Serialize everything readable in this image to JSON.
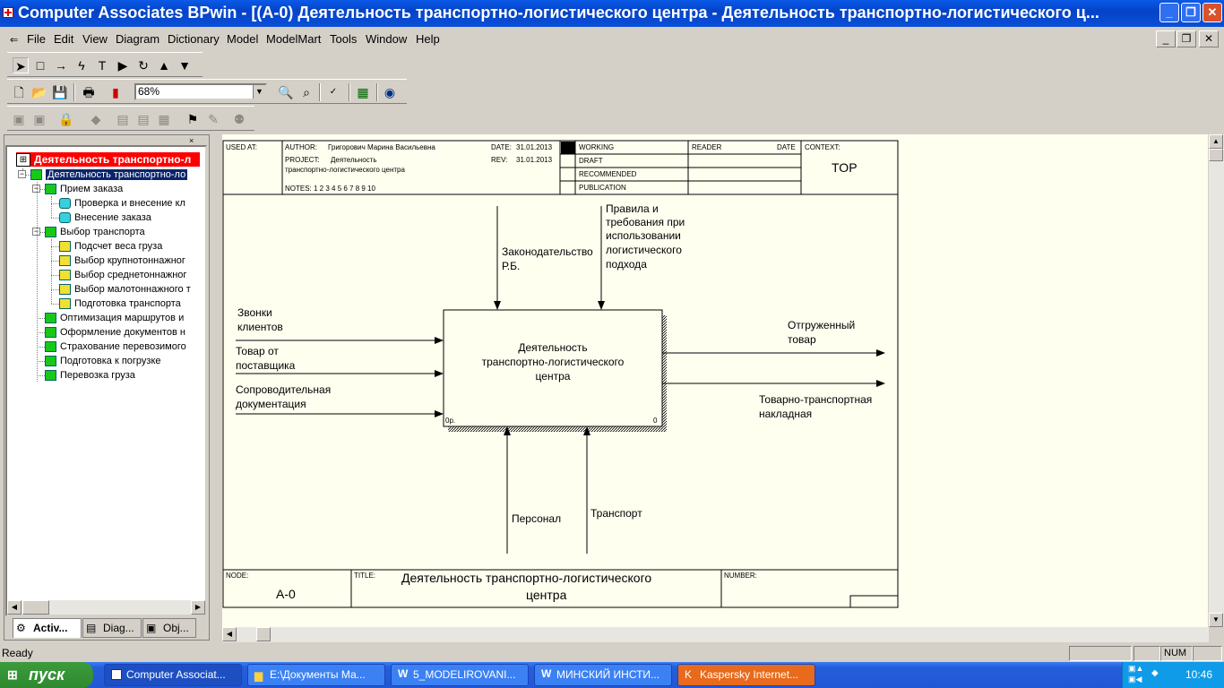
{
  "window": {
    "title": "Computer Associates BPwin - [(A-0) Деятельность  транспортно-логистического  центра - Деятельность транспортно-логистического ц..."
  },
  "menu": [
    "File",
    "Edit",
    "View",
    "Diagram",
    "Dictionary",
    "Model",
    "ModelMart",
    "Tools",
    "Window",
    "Help"
  ],
  "toolbar": {
    "zoom": "68%"
  },
  "tree": {
    "root": "Деятельность транспортно-л",
    "items": [
      {
        "label": "Деятельность транспортно-ло",
        "level": 1,
        "icon": "green",
        "selected": true
      },
      {
        "label": "Прием  заказа",
        "level": 2,
        "icon": "green"
      },
      {
        "label": "Проверка и внесение  кл",
        "level": 3,
        "icon": "cyan"
      },
      {
        "label": "Внесение  заказа",
        "level": 3,
        "icon": "cyan"
      },
      {
        "label": "Выбор  транспорта",
        "level": 2,
        "icon": "green"
      },
      {
        "label": "Подсчет  веса груза",
        "level": 3,
        "icon": "yellow"
      },
      {
        "label": "Выбор крупнотоннажног",
        "level": 3,
        "icon": "yellow"
      },
      {
        "label": "Выбор среднетоннажног",
        "level": 3,
        "icon": "yellow"
      },
      {
        "label": "Выбор малотоннажного т",
        "level": 3,
        "icon": "yellow"
      },
      {
        "label": "Подготовка  транспорта",
        "level": 3,
        "icon": "yellow"
      },
      {
        "label": "Оптимизация маршрутов  и",
        "level": 2,
        "icon": "green"
      },
      {
        "label": "Оформление  документов  н",
        "level": 2,
        "icon": "green"
      },
      {
        "label": "Страхование перевозимого",
        "level": 2,
        "icon": "green"
      },
      {
        "label": "Подготовка к погрузке",
        "level": 2,
        "icon": "green"
      },
      {
        "label": "Перевозка  груза",
        "level": 2,
        "icon": "green"
      }
    ],
    "tabs": [
      "Activ...",
      "Diag...",
      "Obj..."
    ]
  },
  "frame": {
    "used_at": "USED AT:",
    "author_label": "AUTHOR:",
    "author": "Григорович Марина Васильевна",
    "project_label": "PROJECT:",
    "project_1": "Деятельность",
    "project_2": "транспортно-логистического центра",
    "date_label": "DATE:",
    "date": "31.01.2013",
    "rev_label": "REV:",
    "rev": "31.01.2013",
    "notes": "NOTES:  1  2  3  4  5  6  7  8  9  10",
    "working": "WORKING",
    "draft": "DRAFT",
    "recommended": "RECOMMENDED",
    "publication": "PUBLICATION",
    "reader": "READER",
    "date2": "DATE",
    "context": "CONTEXT:",
    "top": "TOP",
    "node_label": "NODE:",
    "node": "A-0",
    "title_label": "TITLE:",
    "title_1": "Деятельность  транспортно-логистического",
    "title_2": "центра",
    "number_label": "NUMBER:"
  },
  "diagram": {
    "box_1": "Деятельность",
    "box_2": "транспортно-логистического",
    "box_3": "центра",
    "box_cost": "0р.",
    "box_num": "0",
    "in1_1": "Звонки",
    "in1_2": "клиентов",
    "in2_1": "Товар от",
    "in2_2": "поставщика",
    "in3_1": "Сопроводительная",
    "in3_2": "документация",
    "ctl1_1": "Законодательство",
    "ctl1_2": "Р.Б.",
    "ctl2_1": "Правила и",
    "ctl2_2": "требования при",
    "ctl2_3": "использовании",
    "ctl2_4": "логистического",
    "ctl2_5": "подхода",
    "out1_1": "Отгруженный",
    "out1_2": "товар",
    "out2_1": "Товарно-транспортная",
    "out2_2": "накладная",
    "mech1": "Персонал",
    "mech2": "Транспорт"
  },
  "status": {
    "text": "Ready",
    "num": "NUM"
  },
  "taskbar": {
    "start": "пуск",
    "buttons": [
      "Computer Associat...",
      "E:\\Документы Ма...",
      "5_MODELIROVANI...",
      "МИНСКИЙ ИНСТИ...",
      "Kaspersky Internet..."
    ],
    "clock": "10:46"
  }
}
